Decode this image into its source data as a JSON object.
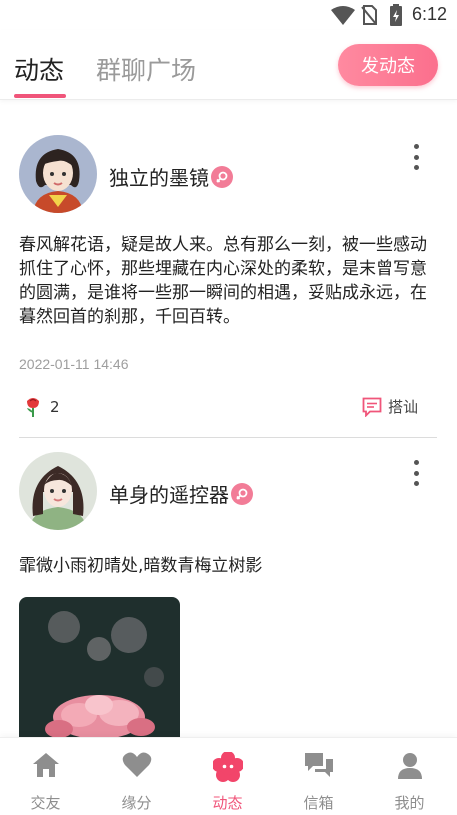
{
  "status_bar": {
    "time": "6:12",
    "icons": [
      "wifi-icon",
      "no-sim-icon",
      "battery-icon"
    ]
  },
  "header": {
    "tabs": [
      {
        "label": "动态",
        "active": true
      },
      {
        "label": "群聊广场",
        "active": false
      }
    ],
    "post_button_label": "发动态",
    "accent_color": "#f0557a"
  },
  "posts": [
    {
      "username": "独立的墨镜",
      "gender_icon": "female-icon",
      "content": "春风解花语，疑是故人来。总有那么一刻，被一些感动抓住了心怀，那些埋藏在内心深处的柔软，是末曾写意的圆满，是谁将一些那一瞬间的相遇，妥贴成永远，在暮然回首的刹那，千回百转。",
      "time": "2022-01-11 14:46",
      "likes": "2",
      "chat_label": "搭讪"
    },
    {
      "username": "单身的遥控器",
      "gender_icon": "female-icon",
      "content": "霏微小雨初晴处,暗数青梅立树影"
    }
  ],
  "bottom_nav": [
    {
      "label": "交友",
      "icon": "home-icon",
      "active": false
    },
    {
      "label": "缘分",
      "icon": "heart-icon",
      "active": false
    },
    {
      "label": "动态",
      "icon": "flower-icon",
      "active": true
    },
    {
      "label": "信箱",
      "icon": "messages-icon",
      "active": false
    },
    {
      "label": "我的",
      "icon": "profile-icon",
      "active": false
    }
  ]
}
